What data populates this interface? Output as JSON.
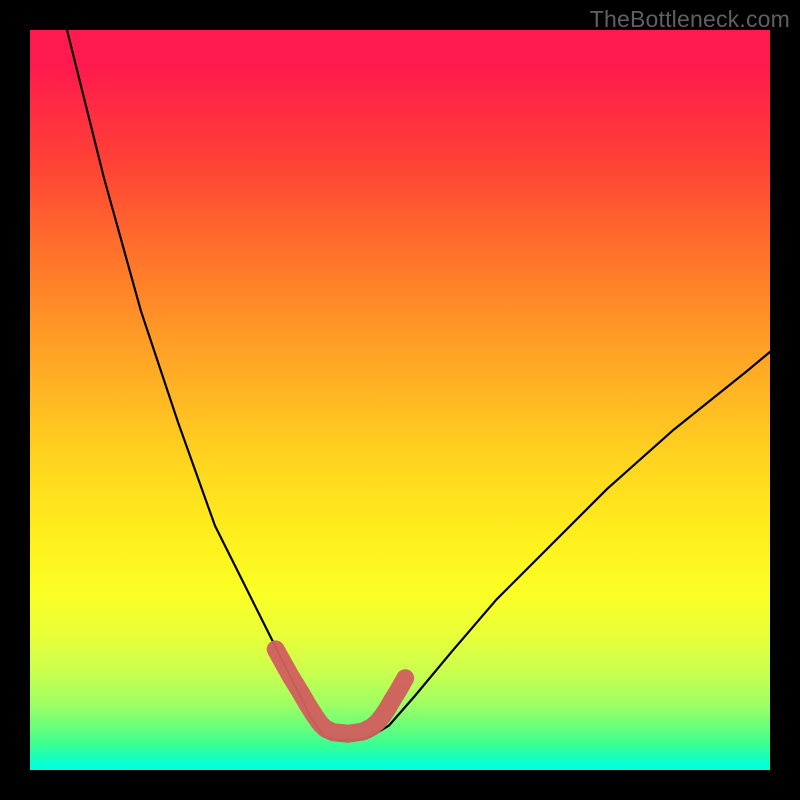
{
  "watermark": "TheBottleneck.com",
  "colors": {
    "background": "#000000",
    "gradient_top": "#ff1a4d",
    "gradient_mid": "#ffee1d",
    "gradient_bottom": "#00ffe0",
    "curve": "#000000",
    "accent_mark": "#d0605e"
  },
  "chart_data": {
    "type": "line",
    "title": "",
    "xlabel": "",
    "ylabel": "",
    "xlim": [
      0,
      100
    ],
    "ylim": [
      0,
      100
    ],
    "grid": false,
    "legend": false,
    "series": [
      {
        "name": "black-curve",
        "x": [
          5,
          10,
          15,
          20,
          25,
          30,
          33,
          36,
          38,
          39.8,
          42,
          44,
          46,
          48.5,
          52,
          57,
          63,
          70,
          78,
          87,
          97,
          100
        ],
        "values": [
          100,
          80,
          62,
          47,
          33,
          23,
          17,
          11,
          7,
          4.5,
          4,
          4,
          4.5,
          6,
          10,
          16,
          23,
          30,
          38,
          46,
          54,
          56.5
        ],
        "note": "values are the Y height of the curve in 0-100 space; 0 = bottom, 100 = top"
      },
      {
        "name": "pink-accent-mark",
        "x": [
          33.2,
          35.2,
          36.5,
          37.6,
          38.5,
          39.2,
          39.9,
          41,
          43,
          45,
          46.2,
          47,
          47.7,
          48.3,
          49,
          49.8,
          50.7
        ],
        "values": [
          16.3,
          12.7,
          10.6,
          8.7,
          7.3,
          6.3,
          5.6,
          5.1,
          4.9,
          5.2,
          5.8,
          6.5,
          7.4,
          8.3,
          9.5,
          10.8,
          12.4
        ],
        "note": "thick rounded salmon stroke overlaying bottom of curve"
      }
    ]
  }
}
